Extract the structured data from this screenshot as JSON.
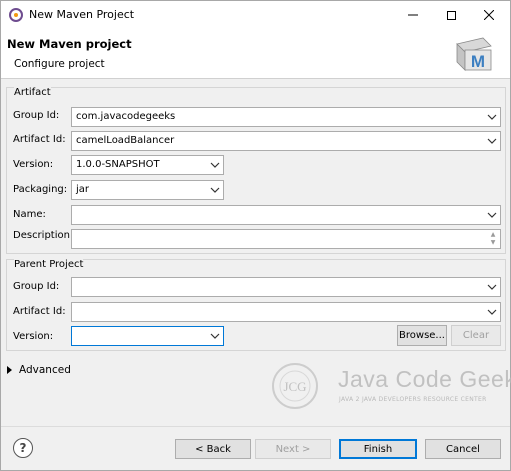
{
  "window": {
    "title": "New Maven Project"
  },
  "banner": {
    "title": "New Maven project",
    "subtitle": "Configure project",
    "logo_text": "M"
  },
  "artifact": {
    "legend": "Artifact",
    "group_id": {
      "label": "Group Id:",
      "value": "com.javacodegeeks"
    },
    "artifact_id": {
      "label": "Artifact Id:",
      "value": "camelLoadBalancer"
    },
    "version": {
      "label": "Version:",
      "value": "1.0.0-SNAPSHOT"
    },
    "packaging": {
      "label": "Packaging:",
      "value": "jar"
    },
    "name": {
      "label": "Name:",
      "value": ""
    },
    "description": {
      "label": "Description:",
      "value": ""
    }
  },
  "parent": {
    "legend": "Parent Project",
    "group_id": {
      "label": "Group Id:",
      "value": ""
    },
    "artifact_id": {
      "label": "Artifact Id:",
      "value": ""
    },
    "version": {
      "label": "Version:",
      "value": ""
    },
    "browse_label": "Browse...",
    "clear_label": "Clear"
  },
  "advanced": {
    "label": "Advanced"
  },
  "watermark": {
    "title": "Java Code Geeks",
    "subtitle": "JAVA 2 JAVA DEVELOPERS RESOURCE CENTER",
    "badge": "JCG"
  },
  "footer": {
    "help_glyph": "?",
    "back_label": "< Back",
    "next_label": "Next >",
    "finish_label": "Finish",
    "cancel_label": "Cancel"
  },
  "colors": {
    "accent": "#0078d7",
    "maven_logo": "#3c7fc1"
  }
}
